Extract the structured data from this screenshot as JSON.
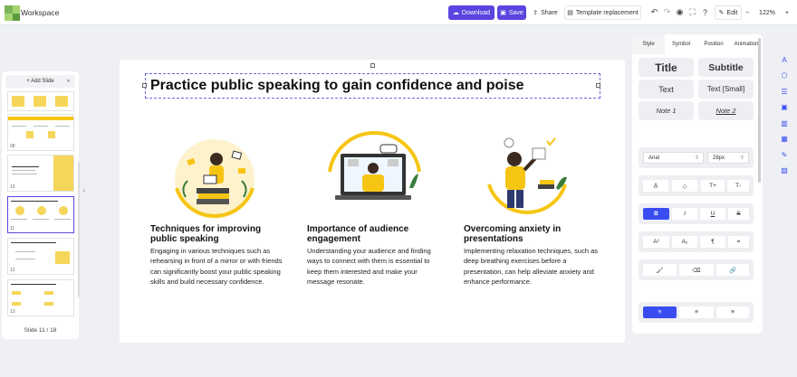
{
  "app": {
    "title": "Workspace"
  },
  "toolbar": {
    "download_label": "Download",
    "save_label": "Save",
    "share_label": "Share",
    "template_label": "Template replacement",
    "edit_label": "Edit",
    "zoom_minus": "−",
    "zoom_value": "122%",
    "zoom_plus": "+"
  },
  "slides_panel": {
    "add_label": "+ Add Slide",
    "thumb_numbers": [
      "",
      "08",
      "10",
      "11",
      "12",
      "13"
    ],
    "count_label": "Slide 11 / 18"
  },
  "slide": {
    "title": "Practice public speaking to gain confidence and poise",
    "columns": [
      {
        "heading": "Techniques for improving public speaking",
        "body": "Engaging in various techniques such as rehearsing in front of a mirror or with friends can significantly boost your public speaking skills and build necessary confidence."
      },
      {
        "heading": "Importance of audience engagement",
        "body": "Understanding your audience and finding ways to connect with them is essential to keep them interested and make your message resonate."
      },
      {
        "heading": "Overcoming anxiety in presentations",
        "body": "Implementing relaxation techniques, such as deep breathing exercises before a presentation, can help alleviate anxiety and enhance performance."
      }
    ]
  },
  "props_panel": {
    "tabs": [
      "Style",
      "Symbol",
      "Position",
      "Animation"
    ],
    "styles": [
      "Title",
      "Subtitle",
      "Text",
      "Text [Small]",
      "Note 1",
      "Note 2"
    ],
    "font_family": "Arial",
    "font_size": "28px",
    "text_tools": [
      "T+",
      "T-"
    ],
    "format_tools": [
      "B",
      "I",
      "U",
      "S"
    ],
    "script_tools": [
      "A²",
      "A₂",
      "¶",
      "❝"
    ]
  },
  "colors": {
    "accent": "#5b45e0",
    "active_blue": "#3a4df0",
    "illustration_yellow": "#f6c514"
  }
}
